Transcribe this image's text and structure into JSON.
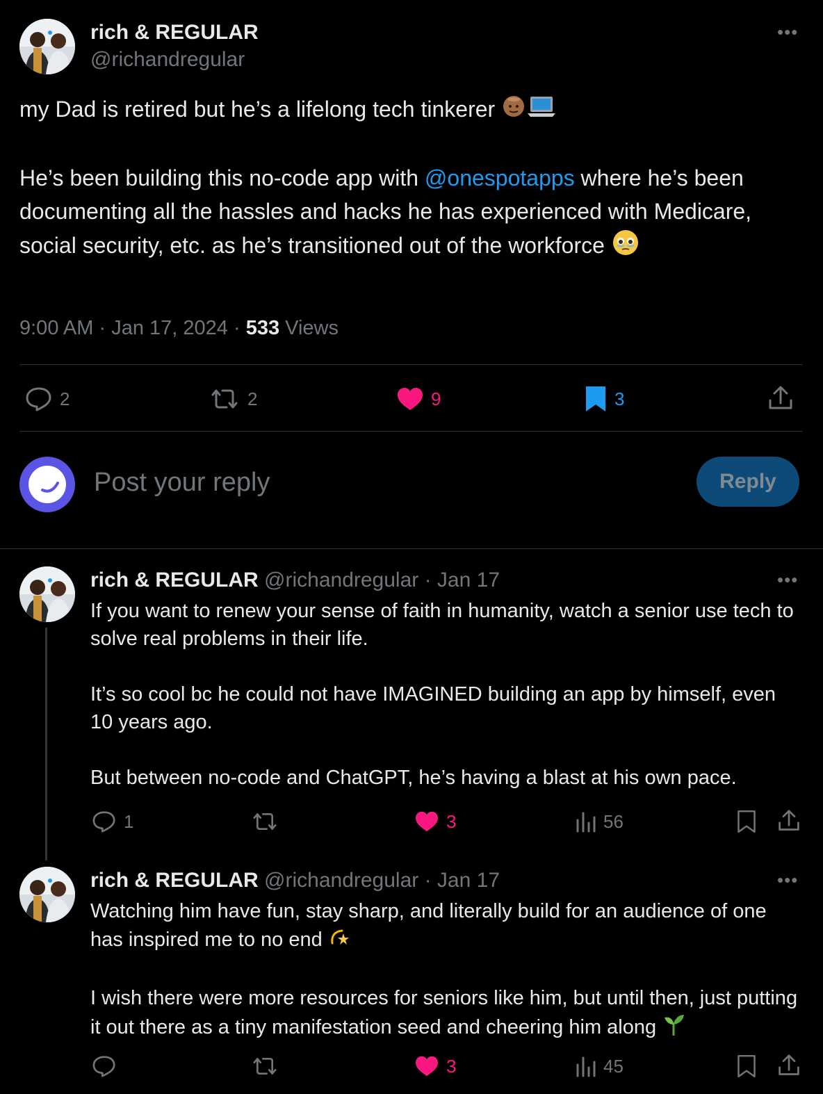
{
  "main_post": {
    "author_name": "rich & REGULAR",
    "author_handle": "@richandregular",
    "line1": "my Dad is retired but he’s a lifelong tech tinkerer",
    "line1_emojis": [
      "man-bald-icon",
      "laptop-icon"
    ],
    "para2_before": "He’s been building this no-code app with ",
    "para2_mention": "@onespotapps",
    "para2_after": " where he’s been documenting all the hassles and hacks he has experienced with Medicare, social security, etc. as he’s transitioned out of the workforce",
    "para2_emoji": "face-holding-back-tears-icon",
    "time": "9:00 AM",
    "date": "Jan 17, 2024",
    "views_count": "533",
    "views_label": "Views",
    "sep": "·",
    "replies": "2",
    "reposts": "2",
    "likes": "9",
    "bookmarks": "3"
  },
  "compose": {
    "placeholder": "Post your reply",
    "button": "Reply"
  },
  "replies": [
    {
      "author_name": "rich & REGULAR",
      "author_handle": "@richandregular",
      "date": "· Jan 17",
      "paragraphs": [
        "If you want to renew your sense of faith in humanity, watch a senior use tech to solve real problems in their life.",
        "It’s so cool bc he could not have IMAGINED building an app by himself, even 10 years ago.",
        "But between no-code and ChatGPT, he’s having a blast at his own pace."
      ],
      "reply_count": "1",
      "repost_count": "",
      "like_count": "3",
      "view_count": "56"
    },
    {
      "author_name": "rich & REGULAR",
      "author_handle": "@richandregular",
      "date": "· Jan 17",
      "paragraphs": [
        "Watching him have fun, stay sharp, and literally build for an audience of one has inspired me to no end",
        "I wish there were more resources for seniors like him, but until then, just putting it out there as a tiny manifestation seed and cheering him along"
      ],
      "emojis": [
        "dizzy-star-icon",
        "seedling-icon"
      ],
      "reply_count": "",
      "repost_count": "",
      "like_count": "3",
      "view_count": "45"
    }
  ],
  "colors": {
    "background": "#000000",
    "text": "#e7e9ea",
    "muted": "#71767b",
    "link": "#1d9bf0",
    "like": "#f91880",
    "divider": "#2f3336",
    "reply_button": "#0d4a78"
  }
}
